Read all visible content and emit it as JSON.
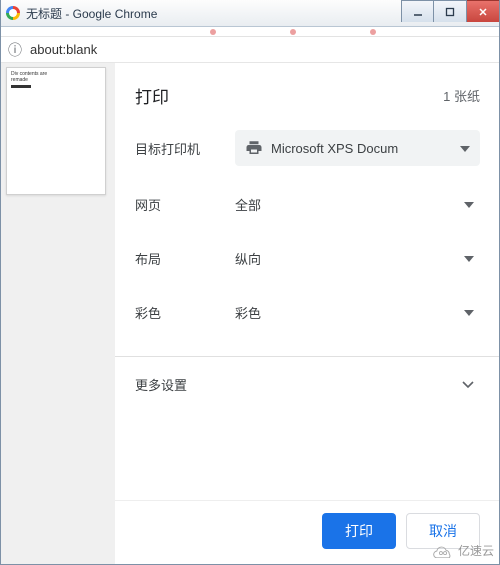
{
  "window": {
    "title": "无标题 - Google Chrome"
  },
  "address": {
    "url": "about:blank"
  },
  "preview": {
    "line1": "Div contents are",
    "line2": "remade"
  },
  "print": {
    "heading": "打印",
    "page_count": "1 张纸",
    "fields": {
      "destination_label": "目标打印机",
      "destination_value": "Microsoft XPS Docum",
      "pages_label": "网页",
      "pages_value": "全部",
      "layout_label": "布局",
      "layout_value": "纵向",
      "color_label": "彩色",
      "color_value": "彩色"
    },
    "more_settings": "更多设置",
    "print_button": "打印",
    "cancel_button": "取消"
  },
  "watermark": {
    "text": "亿速云"
  }
}
